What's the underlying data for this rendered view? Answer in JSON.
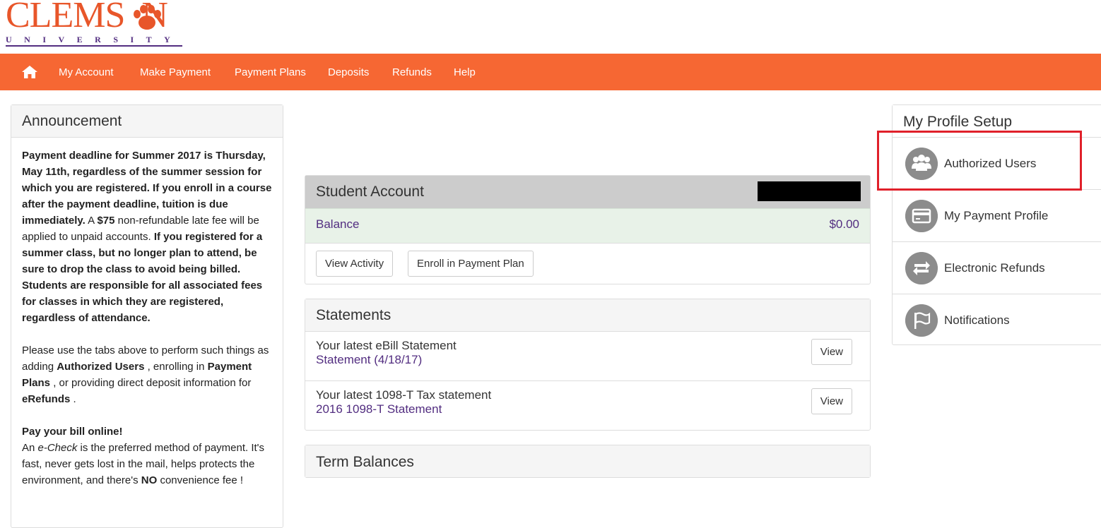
{
  "logo": {
    "word": "CLEMS  N",
    "sub": "UNIVERSITY"
  },
  "nav": {
    "home_icon": "home-icon",
    "items": [
      "My Account",
      "Make Payment",
      "Payment Plans",
      "Deposits",
      "Refunds",
      "Help"
    ]
  },
  "announcement": {
    "title": "Announcement",
    "p1_bold1": "Payment deadline for Summer 2017 is Thursday, May 11th, regardless of the summer session for which you are registered. If you enroll in a course after the payment deadline, tuition is due immediately.",
    "p1_text1": " A ",
    "p1_bold2": "$75",
    "p1_text2": " non-refundable late fee will be applied to unpaid accounts. ",
    "p1_bold3": "If you registered for a summer class, but no longer plan to attend, be sure to drop the class to avoid being billed. Students are responsible for all associated fees for classes in which they are registered, regardless of attendance.",
    "p2_text1": "Please use the tabs above to perform such things as adding ",
    "p2_bold1": "Authorized Users",
    "p2_text2": " , enrolling in ",
    "p2_bold2": "Payment Plans",
    "p2_text3": " , or providing direct deposit information for ",
    "p2_bold3": "eRefunds",
    "p2_text4": " .",
    "p3_bold": "Pay your bill online!",
    "p3_text1": "An ",
    "p3_italic": "e-Check",
    "p3_text2": " is the preferred method of payment. It's fast, never gets lost in the mail, helps protects the environment, and there's ",
    "p3_bold2": "NO",
    "p3_text3": " convenience fee !"
  },
  "account": {
    "title": "Student Account",
    "balance_label": "Balance",
    "balance_value": "$0.00",
    "view_activity": "View Activity",
    "enroll_plan": "Enroll in Payment Plan"
  },
  "statements": {
    "title": "Statements",
    "rows": [
      {
        "title": "Your latest eBill Statement",
        "link": "Statement (4/18/17)",
        "button": "View"
      },
      {
        "title": "Your latest 1098-T Tax statement",
        "link": "2016 1098-T Statement",
        "button": "View"
      }
    ]
  },
  "terms": {
    "title": "Term Balances"
  },
  "profile": {
    "title": "My Profile Setup",
    "items": [
      {
        "label": "Authorized Users",
        "icon": "users-icon"
      },
      {
        "label": "My Payment Profile",
        "icon": "credit-card-icon"
      },
      {
        "label": "Electronic Refunds",
        "icon": "refresh-icon"
      },
      {
        "label": "Notifications",
        "icon": "flag-icon"
      }
    ]
  },
  "colors": {
    "brand_orange": "#f66733",
    "brand_purple": "#522d80",
    "highlight_red": "#e0202a"
  }
}
